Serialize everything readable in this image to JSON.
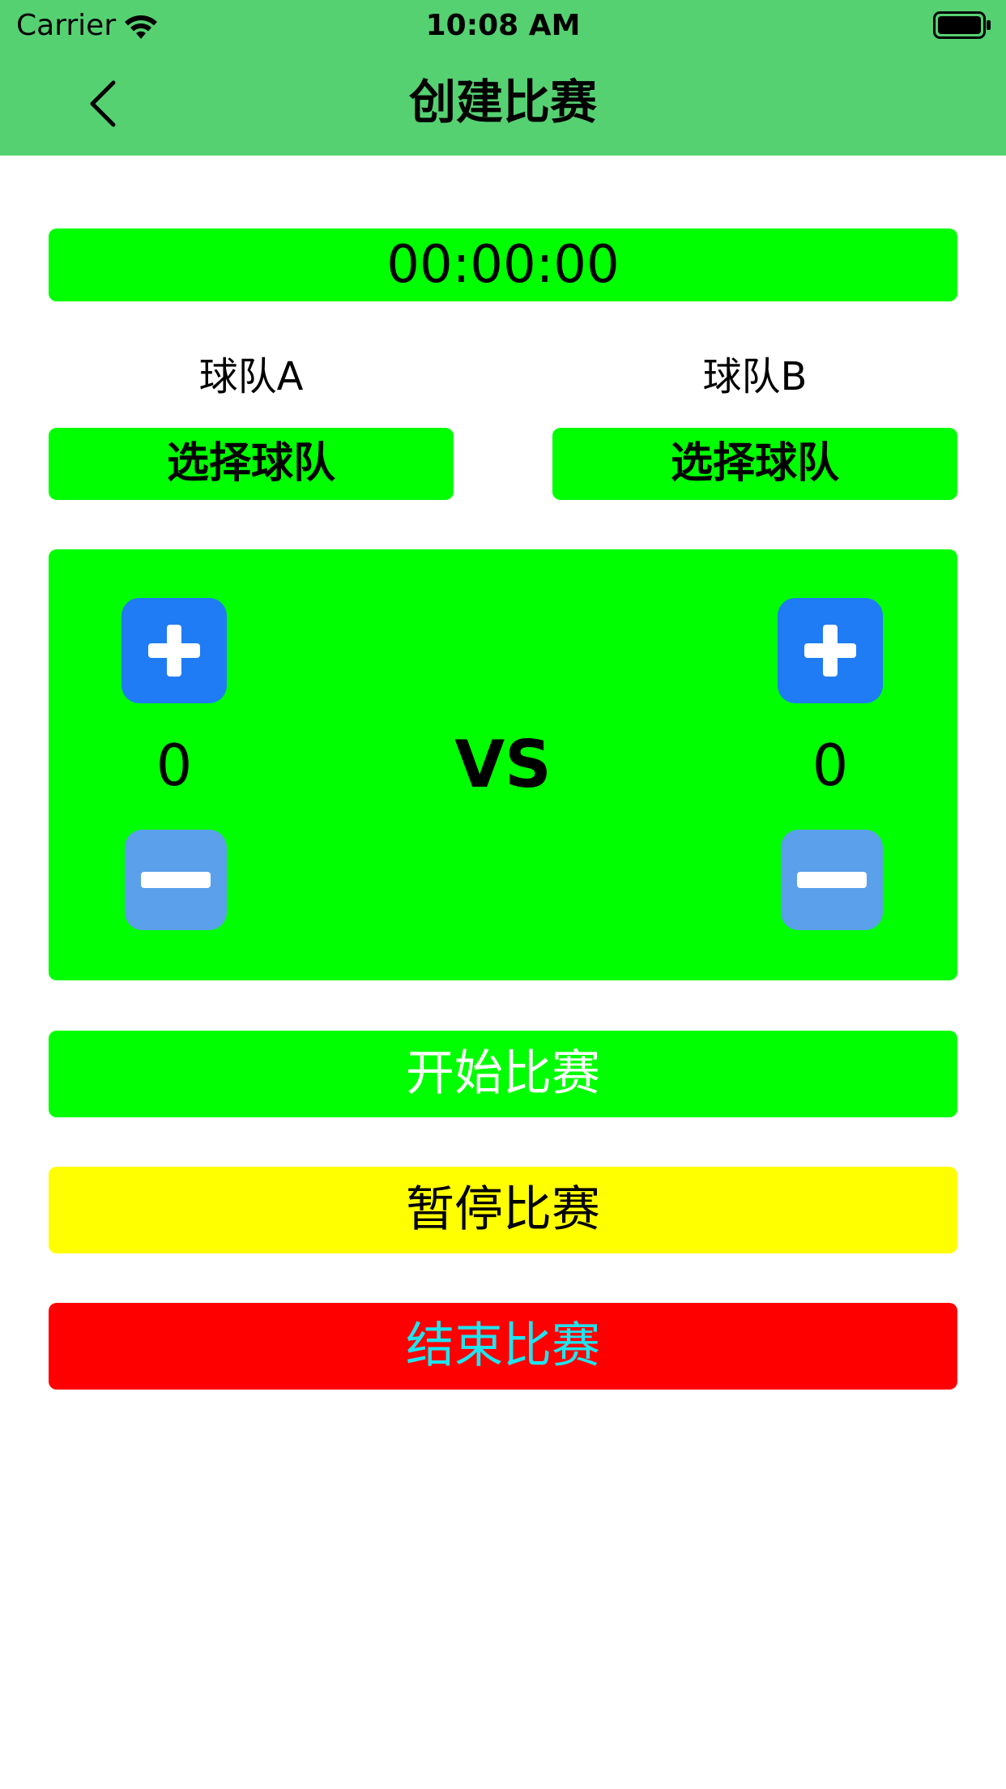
{
  "status_bar": {
    "carrier": "Carrier",
    "time": "10:08 AM"
  },
  "nav": {
    "title": "创建比赛",
    "back_icon": "chevron-left-icon"
  },
  "timer": {
    "value": "00:00:00"
  },
  "teams": {
    "a": {
      "label": "球队A",
      "select_label": "选择球队",
      "score": "0"
    },
    "b": {
      "label": "球队B",
      "select_label": "选择球队",
      "score": "0"
    }
  },
  "scoreboard": {
    "vs_label": "VS",
    "plus_icon": "plus-icon",
    "minus_icon": "minus-icon"
  },
  "actions": {
    "start_label": "开始比赛",
    "pause_label": "暂停比赛",
    "end_label": "结束比赛"
  },
  "colors": {
    "nav_background": "#56d172",
    "panel_green": "#00ff00",
    "plus_blue": "#1f7cf5",
    "minus_blue": "#5ba0ea",
    "pause_yellow": "#ffff00",
    "end_red": "#ff0000",
    "end_text_cyan": "#1ee4f0"
  }
}
